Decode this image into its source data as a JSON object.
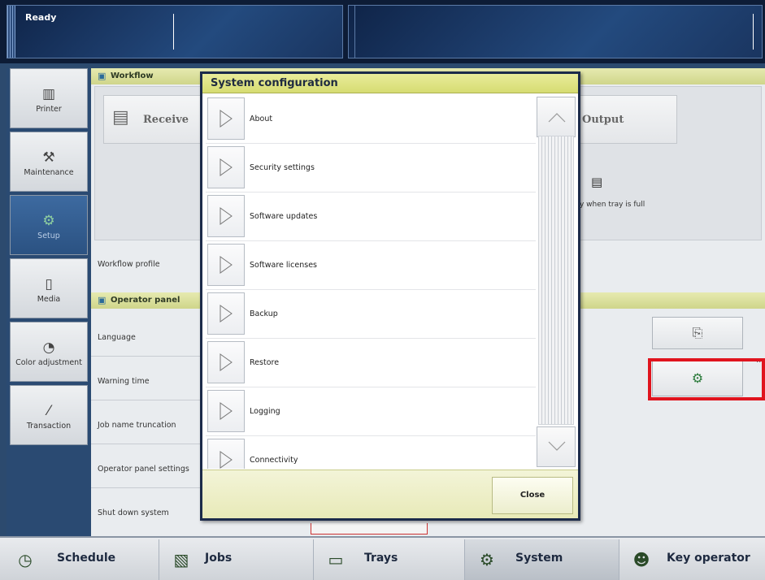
{
  "status": {
    "text": "Ready"
  },
  "nav": [
    {
      "label": "Printer",
      "icon": "printer-icon"
    },
    {
      "label": "Maintenance",
      "icon": "maintenance-icon"
    },
    {
      "label": "Setup",
      "icon": "setup-icon",
      "active": true
    },
    {
      "label": "Media",
      "icon": "media-icon"
    },
    {
      "label": "Color adjustment",
      "icon": "color-adjustment-icon"
    },
    {
      "label": "Transaction",
      "icon": "transaction-icon"
    }
  ],
  "workflow": {
    "header": "Workflow",
    "receive": "Receive",
    "output": "Output",
    "tray_note": "y when tray is full",
    "profile_label": "Workflow profile"
  },
  "operator_panel": {
    "header": "Operator panel",
    "rows": [
      "Language",
      "Warning time",
      "Job name truncation",
      "Operator panel settings",
      "Shut down system"
    ]
  },
  "dialog": {
    "title": "System configuration",
    "items": [
      "About",
      "Security settings",
      "Software updates",
      "Software licenses",
      "Backup",
      "Restore",
      "Logging",
      "Connectivity"
    ],
    "close": "Close"
  },
  "more_dots": "...",
  "taskbar": [
    {
      "label": "Schedule",
      "icon": "clock-icon"
    },
    {
      "label": "Jobs",
      "icon": "jobs-icon"
    },
    {
      "label": "Trays",
      "icon": "trays-icon"
    },
    {
      "label": "System",
      "icon": "system-gear-icon",
      "active": true
    },
    {
      "label": "Key operator",
      "icon": "key-operator-icon"
    }
  ],
  "colors": {
    "accent_yellow": "#d6dc72",
    "highlight_red": "#e0141e",
    "nav_active": "#2b5282"
  }
}
